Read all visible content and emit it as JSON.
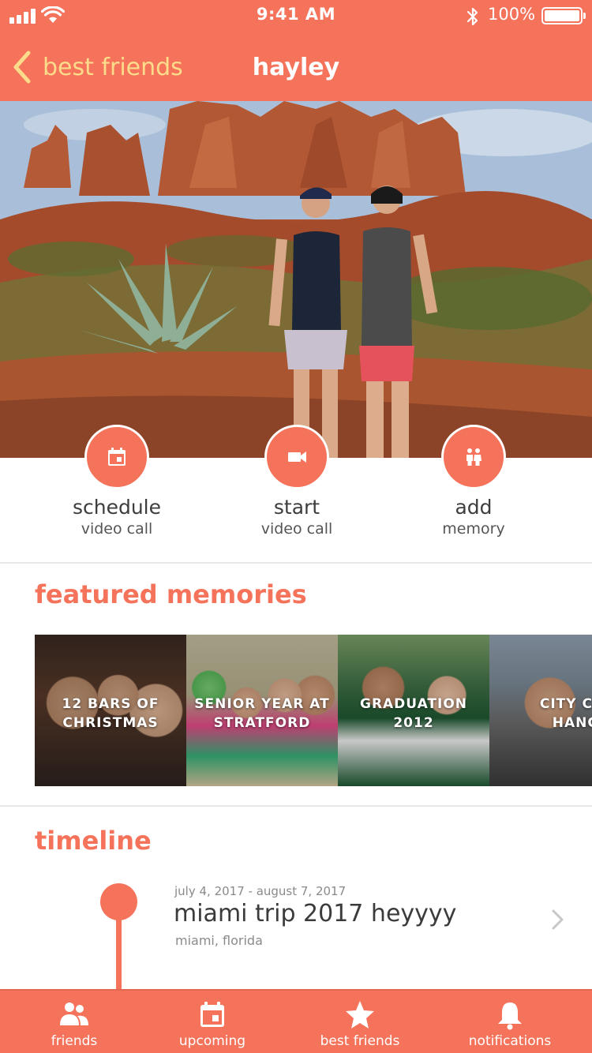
{
  "status_bar": {
    "time": "9:41 AM",
    "battery": "100%",
    "icons": [
      "signal-icon",
      "wifi-icon",
      "bluetooth-icon",
      "battery-icon"
    ]
  },
  "nav": {
    "back_label": "best friends",
    "title": "hayley"
  },
  "actions": [
    {
      "title": "schedule",
      "subtitle": "video call",
      "icon": "calendar-icon"
    },
    {
      "title": "start",
      "subtitle": "video call",
      "icon": "video-camera-icon"
    },
    {
      "title": "add",
      "subtitle": "memory",
      "icon": "people-icon"
    }
  ],
  "featured": {
    "title": "featured memories",
    "memories": [
      {
        "label": "12 BARS OF CHRISTMAS"
      },
      {
        "label": "SENIOR YEAR AT STRATFORD"
      },
      {
        "label": "GRADUATION 2012"
      },
      {
        "label": "CITY CENTER HANGOUT"
      }
    ]
  },
  "timeline": {
    "title": "timeline",
    "items": [
      {
        "dates": "july 4, 2017 - august 7, 2017",
        "title": "miami trip 2017 heyyyy",
        "location": "miami, florida"
      }
    ]
  },
  "tabs": [
    {
      "label": "friends",
      "icon": "friends-icon"
    },
    {
      "label": "upcoming",
      "icon": "calendar-icon"
    },
    {
      "label": "best friends",
      "icon": "star-icon"
    },
    {
      "label": "notifications",
      "icon": "bell-icon"
    }
  ],
  "colors": {
    "accent": "#F5735B",
    "back_link": "#FCDC8B",
    "text": "#3b3b3b",
    "muted": "#8a8a8a"
  }
}
